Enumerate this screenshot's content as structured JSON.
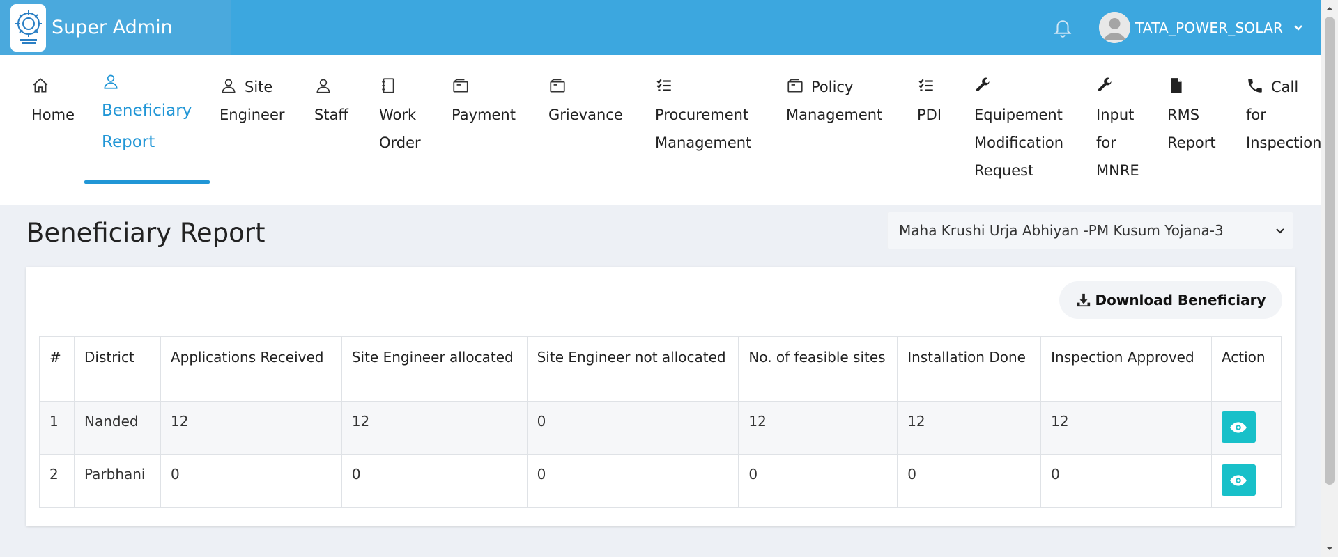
{
  "app": {
    "title": "Super Admin"
  },
  "header": {
    "user_name": "TATA_POWER_SOLAR"
  },
  "nav": {
    "home": [
      "Home"
    ],
    "beneficiary": [
      "Beneficiary",
      "Report"
    ],
    "site_engineer": [
      "Site",
      "Engineer"
    ],
    "staff": [
      "Staff"
    ],
    "work_order": [
      "Work",
      "Order"
    ],
    "payment": [
      "Payment"
    ],
    "grievance": [
      "Grievance"
    ],
    "procurement": [
      "Procurement",
      "Management"
    ],
    "policy": [
      "Policy",
      "Management"
    ],
    "pdi": [
      "PDI"
    ],
    "equipment": [
      "Equipement",
      "Modification",
      "Request"
    ],
    "input_mnre": [
      "Input",
      "for",
      "MNRE"
    ],
    "rms": [
      "RMS",
      "Report"
    ],
    "call_inspection": [
      "Call",
      "for",
      "Inspection"
    ]
  },
  "page": {
    "title": "Beneficiary Report",
    "scheme_select": "Maha Krushi Urja Abhiyan -PM Kusum Yojana-3",
    "download_label": "Download Beneficiary"
  },
  "table": {
    "headers": [
      "#",
      "District",
      "Applications Received",
      "Site Engineer allocated",
      "Site Engineer not allocated",
      "No. of feasible sites",
      "Installation Done",
      "Inspection Approved",
      "Action"
    ],
    "rows": [
      [
        "1",
        "Nanded",
        "12",
        "12",
        "0",
        "12",
        "12",
        "12"
      ],
      [
        "2",
        "Parbhani",
        "0",
        "0",
        "0",
        "0",
        "0",
        "0"
      ]
    ]
  },
  "colors": {
    "topbar": "#3ca7df",
    "accent": "#2196d6",
    "view_button": "#18c0c9"
  }
}
